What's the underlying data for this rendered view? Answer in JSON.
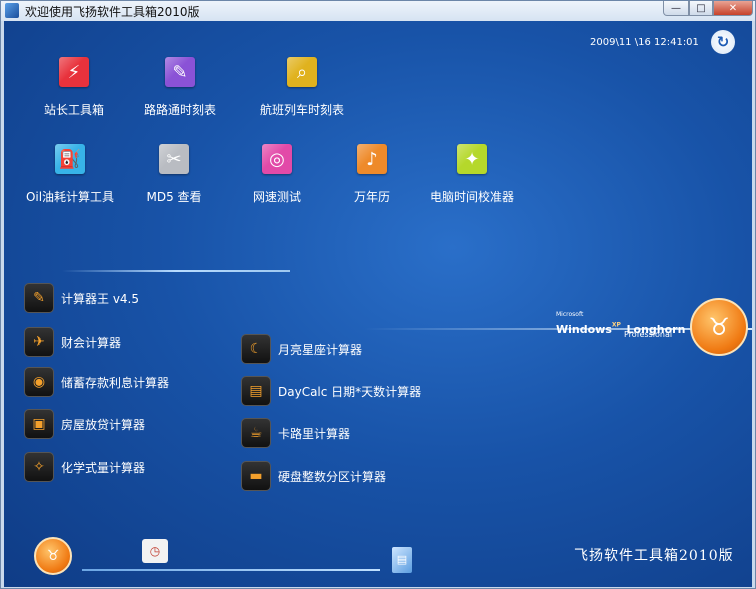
{
  "window": {
    "title": "欢迎使用飞扬软件工具箱2010版",
    "min": "—",
    "max": "□",
    "close": "✕"
  },
  "clock": "2009\\11 \\16  12:41:01",
  "refresh_glyph": "↻",
  "tiles": [
    {
      "label": "站长工具箱",
      "color": "#e8323c",
      "glyph": "⚡"
    },
    {
      "label": "路路通时刻表",
      "color": "#8a52d6",
      "glyph": "✎"
    },
    {
      "label": "航班列车时刻表",
      "color": "#e0b21e",
      "glyph": "⌕"
    },
    {
      "label": "Oil油耗计算工具",
      "color": "#37b3e8",
      "glyph": "⛽"
    },
    {
      "label": "MD5 查看",
      "color": "#b9bcc2",
      "glyph": "✂"
    },
    {
      "label": "网速测试",
      "color": "#e24aa8",
      "glyph": "◎"
    },
    {
      "label": "万年历",
      "color": "#ee8a2a",
      "glyph": "♪"
    },
    {
      "label": "电脑时间校准器",
      "color": "#b5d82b",
      "glyph": "✦"
    }
  ],
  "tools": [
    {
      "label": "计算器王 v4.5",
      "glyph": "✎"
    },
    {
      "label": "财会计算器",
      "glyph": "✈"
    },
    {
      "label": "储蓄存款利息计算器",
      "glyph": "◉"
    },
    {
      "label": "房屋放贷计算器",
      "glyph": "▣"
    },
    {
      "label": "化学式量计算器",
      "glyph": "✧"
    },
    {
      "label": "月亮星座计算器",
      "glyph": "☾"
    },
    {
      "label": "DayCalc 日期*天数计算器",
      "glyph": "▤"
    },
    {
      "label": "卡路里计算器",
      "glyph": "☕"
    },
    {
      "label": "硬盘整数分区计算器",
      "glyph": "▬"
    }
  ],
  "logo": {
    "microsoft": "Microsoft",
    "windows": "Windows",
    "xp": "XP",
    "longhorn": "Longhorn",
    "professional": "Professional"
  },
  "badge_glyph": "♉",
  "brand": "飞扬软件工具箱2010版"
}
